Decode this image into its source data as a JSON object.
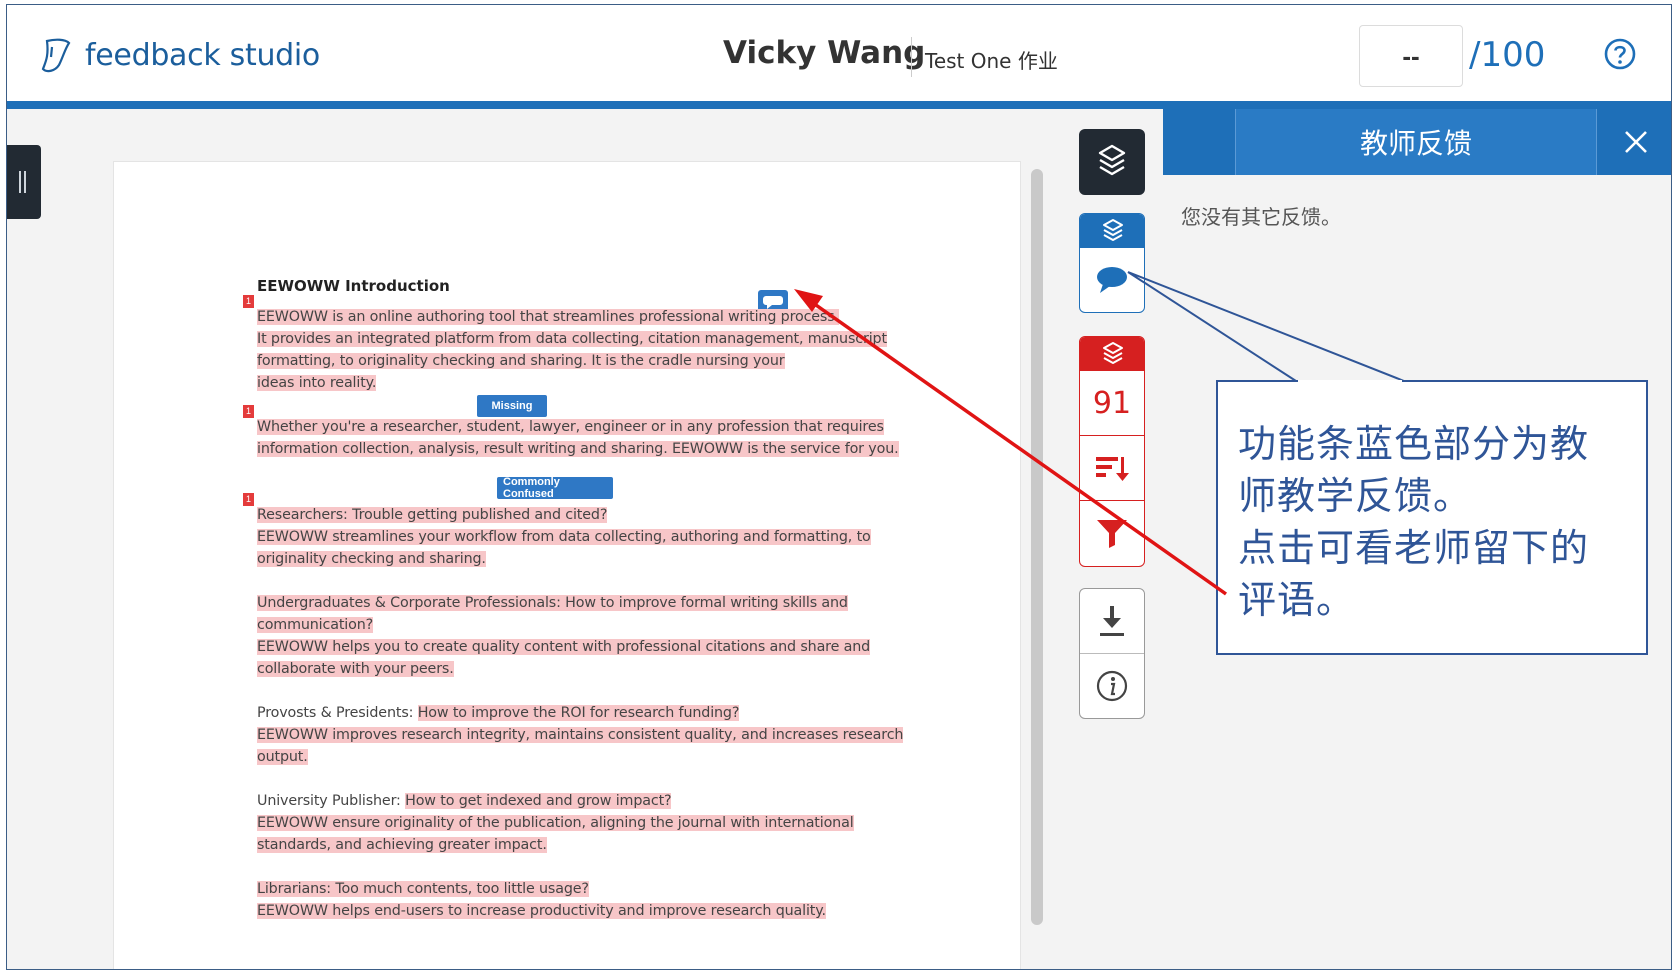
{
  "header": {
    "app_name": "feedback studio",
    "student_name": "Vicky Wang",
    "assignment_name": "Test One 作业",
    "score_value": "--",
    "score_total": "/100"
  },
  "document": {
    "title": "EEWOWW Introduction",
    "flag_label": "1",
    "paragraph_1": [
      "EEWOWW is an online authoring tool that streamlines professional writing process.",
      "It provides an integrated platform from data collecting, citation management, manuscript",
      "formatting, to originality checking and sharing. It is the cradle nursing your",
      "ideas into reality."
    ],
    "tag_missing": "Missing",
    "paragraph_2": [
      "Whether you're a researcher, student, lawyer, engineer or in any profession that requires",
      "information collection, analysis, result writing and sharing. EEWOWW is the service for you."
    ],
    "tag_confused": "Commonly Confused",
    "paragraph_3": [
      "Researchers: Trouble getting published and cited?",
      "EEWOWW streamlines your workflow from data collecting, authoring and formatting, to",
      "originality checking and sharing."
    ],
    "paragraph_4": [
      "Undergraduates & Corporate Professionals: How to improve formal writing skills and",
      "communication?",
      "EEWOWW helps you to create quality content with professional citations and share and",
      "collaborate with your peers."
    ],
    "paragraph_5": {
      "lead": "Provosts & Presidents: ",
      "question": "How to improve the ROI for research funding?",
      "lines": [
        "EEWOWW improves research integrity, maintains consistent quality, and increases research",
        "output."
      ]
    },
    "paragraph_6": {
      "lead": "University Publisher: ",
      "question": "How to get indexed and grow impact?",
      "lines": [
        "EEWOWW ensure originality of the publication, aligning the journal with international",
        "standards, and achieving greater impact."
      ]
    },
    "paragraph_7": [
      "Librarians: Too much contents, too little usage?",
      "EEWOWW helps end-users to increase productivity and improve research quality."
    ]
  },
  "toolbar": {
    "similarity_count": "91"
  },
  "panel": {
    "title": "教师反馈",
    "empty_message": "您没有其它反馈。"
  },
  "callout": {
    "lines": [
      "功能条蓝色部分为教",
      "师教学反馈。",
      "点击可看老师留下的",
      "评语。"
    ]
  },
  "colors": {
    "brand_blue": "#1e6fb8",
    "alert_red": "#d62020",
    "highlight_pink": "#f7c6c8",
    "callout_blue": "#2f5597"
  },
  "icons": {
    "logo": "feedback-studio-logo-icon",
    "help": "help-circle-icon",
    "layers": "layers-icon",
    "comment": "comment-bubble-icon",
    "sort": "sort-icon",
    "filter": "filter-icon",
    "download": "download-icon",
    "info": "info-icon",
    "close": "close-icon"
  }
}
